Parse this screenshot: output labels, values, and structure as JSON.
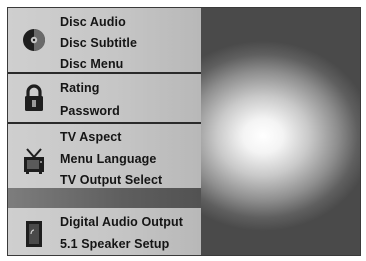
{
  "menu": {
    "disc_group": {
      "icon": "disc-icon",
      "items": [
        "Disc Audio",
        "Disc Subtitle",
        "Disc Menu"
      ]
    },
    "lock_group": {
      "icon": "padlock-icon",
      "items": [
        "Rating",
        "Password"
      ]
    },
    "tv_group": {
      "icon": "tv-antenna-icon",
      "items": [
        "TV Aspect",
        "Menu Language",
        "TV Output Select"
      ]
    },
    "audio_group": {
      "icon": "speaker-icon",
      "items": [
        "Digital Audio Output",
        "5.1 Speaker Setup"
      ]
    }
  },
  "colors": {
    "panel": "#c8c8c8",
    "text": "#151515",
    "separator": "#2a2a2a",
    "background_dark": "#4a4a4a",
    "glow": "#ffffff"
  }
}
